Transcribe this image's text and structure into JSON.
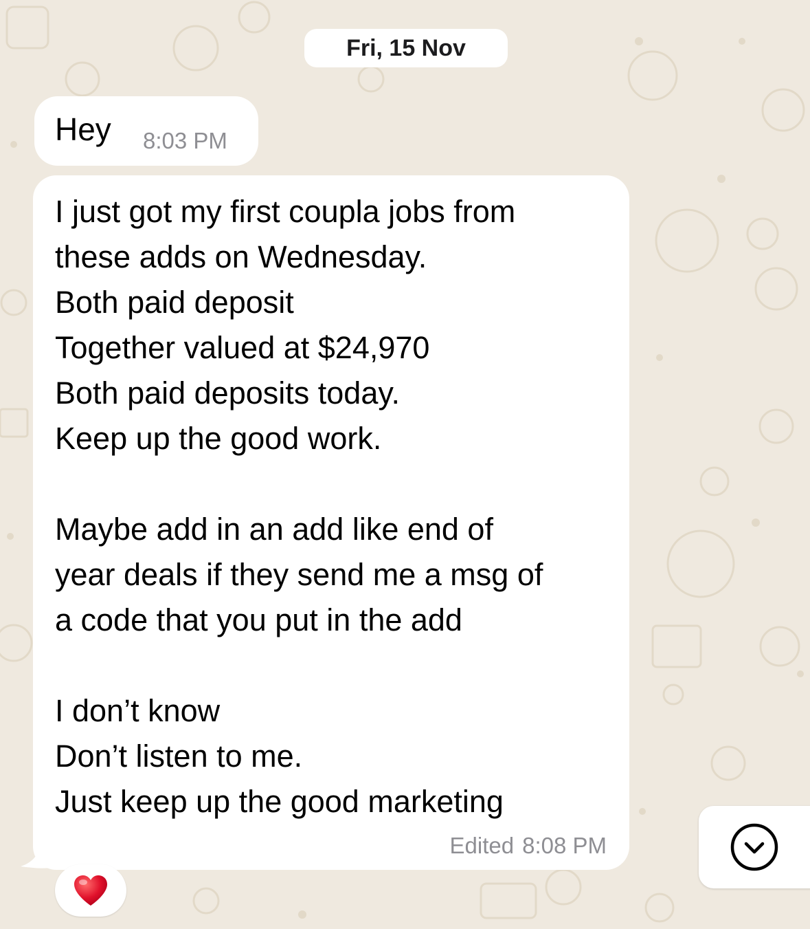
{
  "date_separator": "Fri, 15 Nov",
  "messages": [
    {
      "text": "Hey",
      "time": "8:03 PM"
    },
    {
      "lines": [
        "I just got my first coupla jobs from",
        "these adds on Wednesday.",
        "Both paid deposit",
        "Together valued at $24,970",
        "Both paid deposits today.",
        "Keep up the good work.",
        "",
        "Maybe add in an add like end of",
        "year deals if they send me a msg of",
        "a code that you put in the add",
        "",
        "I don’t know",
        "Don’t listen to me.",
        "Just keep up the good marketing"
      ],
      "edited_label": "Edited",
      "time": "8:08 PM",
      "reaction": "heart-icon"
    }
  ],
  "scroll_button": "chevron-down-icon",
  "colors": {
    "background": "#efe9df",
    "bubble": "#ffffff",
    "timestamp": "#8e8e93",
    "heart": "#e0112b"
  }
}
